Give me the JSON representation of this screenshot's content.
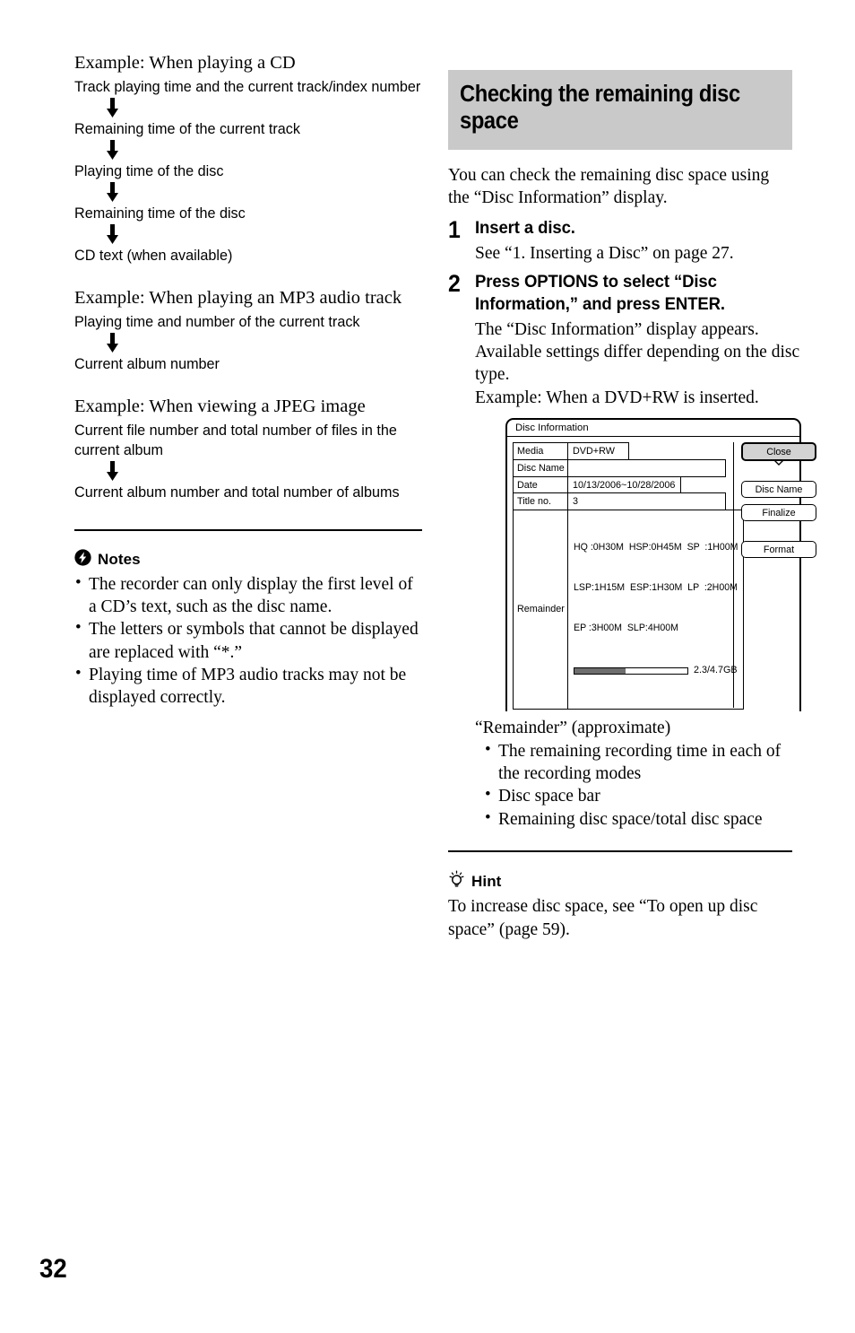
{
  "page": {
    "number": "32"
  },
  "left_column": {
    "cd_example": {
      "heading": "Example: When playing a CD",
      "steps": [
        "Track playing time and the current track/index number",
        "Remaining time of the current track",
        "Playing time of the disc",
        "Remaining time of the disc",
        "CD text (when available)"
      ]
    },
    "mp3_example": {
      "heading": "Example: When playing an MP3 audio track",
      "steps": [
        "Playing time and number of the current track",
        "Current album number"
      ]
    },
    "jpeg_example": {
      "heading": "Example: When viewing a JPEG image",
      "steps": [
        "Current file number and total number of files in the current album",
        "Current album number and total number of albums"
      ]
    },
    "notes": {
      "icon": "notes-lightning-icon",
      "title": "Notes",
      "items": [
        "The recorder can only display the first level of a CD’s text, such as the disc name.",
        "The letters or symbols that cannot be displayed are replaced with “*.”",
        "Playing time of MP3 audio tracks may not be displayed correctly."
      ]
    }
  },
  "right_column": {
    "section_title": "Checking the remaining disc space",
    "section_title_bg": "#c9c9c9",
    "intro": "You can check the remaining disc space using the “Disc Information” display.",
    "steps": [
      {
        "number": "1",
        "title": "Insert a disc.",
        "text": "See “1. Inserting a Disc” on page 27."
      },
      {
        "number": "2",
        "title": "Press OPTIONS to select “Disc Information,” and press ENTER.",
        "text": "The “Disc Information” display appears. Available settings differ depending on the disc type.\nExample: When a DVD+RW is inserted."
      }
    ],
    "disc_information_dialog": {
      "title": "Disc Information",
      "rows": [
        {
          "label": "Media",
          "value": "DVD+RW",
          "width": "shrink"
        },
        {
          "label": "Disc Name",
          "value": "",
          "width": "fill"
        },
        {
          "label": "Date",
          "value": "10/13/2006~10/28/2006",
          "width": "shrink"
        },
        {
          "label": "Title no.",
          "value": "3",
          "width": "fill"
        }
      ],
      "remainder": {
        "label": "Remainder",
        "lines": [
          "HQ :0H30M  HSP:0H45M  SP  :1H00M",
          "LSP:1H15M  ESP:1H30M  LP  :2H00M",
          "EP :3H00M  SLP:4H00M"
        ],
        "space_used_percent": 45,
        "space_total": "2.3/4.7GB",
        "bar_fill_color": "#6e6e6e"
      },
      "buttons": [
        {
          "label": "Close",
          "selected": true
        },
        {
          "label": "Disc Name",
          "selected": false
        },
        {
          "label": "Finalize",
          "selected": false
        },
        {
          "label": "Format",
          "selected": false
        }
      ]
    },
    "caption": {
      "title": "“Remainder” (approximate)",
      "items": [
        "The remaining recording time in each of the recording modes",
        "Disc space bar",
        "Remaining disc space/total disc space"
      ]
    },
    "hint": {
      "icon": "hint-lightbulb-icon",
      "title": "Hint",
      "text": "To increase disc space, see “To open up disc space” (page 59)."
    }
  }
}
